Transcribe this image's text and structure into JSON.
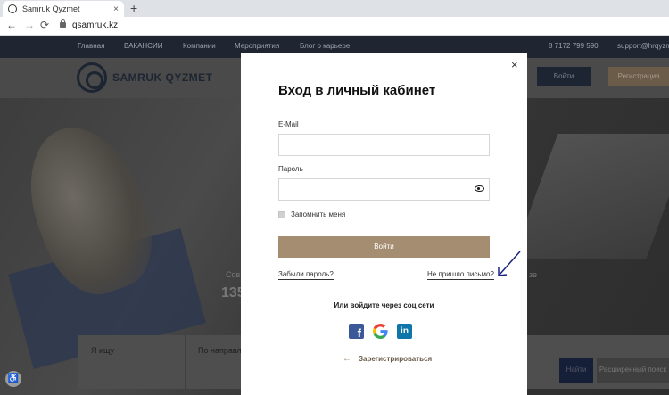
{
  "browser": {
    "tab_title": "Samruk Qyzmet",
    "tab_close": "×",
    "new_tab": "+",
    "url": "qsamruk.kz"
  },
  "site": {
    "topbar": {
      "nav": [
        "Главная",
        "ВАКАНСИИ",
        "Компании",
        "Мероприятия",
        "Блог о карьере"
      ],
      "phone": "8 7172 799 590",
      "email": "support@hrqyzmet"
    },
    "header": {
      "logo_text": "SAMRUK QYZMET",
      "login_btn": "Войти",
      "register_btn": "Регистрация"
    },
    "hero": {
      "small_text_left": "Сов",
      "small_text_right": "зе",
      "big_number": "135"
    },
    "search": {
      "field1": "Я ищу",
      "field2": "По направле",
      "btn_dark": "Найти",
      "btn_gray": "Расширенный поиск"
    }
  },
  "modal": {
    "close": "×",
    "title": "Вход в личный кабинет",
    "email_label": "E-Mail",
    "email_value": "",
    "password_label": "Пароль",
    "password_value": "",
    "remember_label": "Запомнить меня",
    "login_button": "Войти",
    "forgot_link": "Забыли пароль?",
    "no_email_link": "Не пришло письмо?",
    "social_title": "Или войдите через соц сети",
    "social": {
      "facebook": "f",
      "google": "G",
      "linkedin": "in"
    },
    "register_arrow": "←",
    "register_link": "Зарегистрироваться"
  },
  "icons": [
    "eye-icon",
    "facebook-icon",
    "google-icon",
    "linkedin-icon",
    "close-icon",
    "lock-icon",
    "arrow-left-icon",
    "accessibility-icon"
  ],
  "colors": {
    "login_button": "#a58d72",
    "register_text": "#6b5c4a",
    "facebook": "#3b5998",
    "linkedin": "#0e76a8",
    "annotation_arrow": "#1a237e"
  }
}
